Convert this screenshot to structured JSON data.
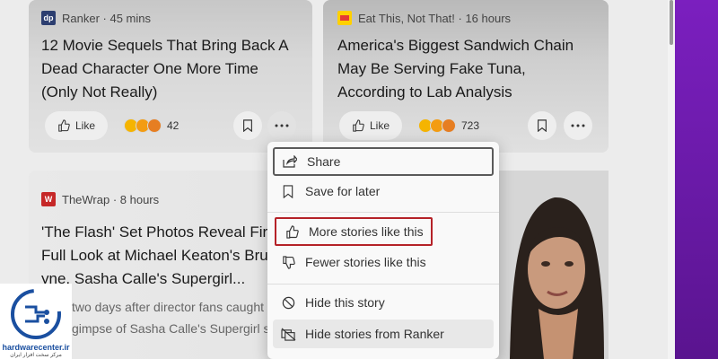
{
  "cards": {
    "card1": {
      "source": "Ranker",
      "time": "45 mins",
      "source_line": "Ranker · 45 mins",
      "logo_text": "dp",
      "headline_lines": [
        "12 Movie Sequels That Bring Back A",
        "Dead Character One More Time",
        "(Only Not Really)"
      ],
      "like_label": "Like",
      "reaction_count": "42"
    },
    "card2": {
      "source_line": "Eat This, Not That! · 16 hours",
      "headline_lines": [
        "America's Biggest Sandwich Chain",
        "May Be Serving Fake Tuna,",
        "According to Lab Analysis"
      ],
      "like_label": "Like",
      "reaction_count": "723"
    },
    "card3": {
      "source_line": "TheWrap · 8 hours",
      "logo_text": "W",
      "headline_lines": [
        "'The Flash' Set Photos Reveal Firs",
        "Full Look at Michael Keaton's Bru",
        "yne, Sasha Calle's Supergirl..."
      ],
      "snippet_lines": [
        "two days after director fans caught",
        "gimpse of Sasha Calle's Supergirl suit"
      ]
    }
  },
  "menu": {
    "items": [
      {
        "label": "Share",
        "icon": "share-icon"
      },
      {
        "label": "Save for later",
        "icon": "bookmark-icon"
      },
      {
        "label": "More stories like this",
        "icon": "thumbs-up-icon"
      },
      {
        "label": "Fewer stories like this",
        "icon": "thumbs-down-icon"
      },
      {
        "label": "Hide this story",
        "icon": "block-icon"
      },
      {
        "label": "Hide stories from Ranker",
        "icon": "hide-source-icon"
      }
    ]
  },
  "watermark": {
    "line1": "hardwarecenter.ir",
    "line2": "مرکز سخت افزار ایران"
  },
  "colors": {
    "highlight_border": "#b52228",
    "purple_accent": "#6a1aa8",
    "ranker_logo": "#2c3e70",
    "eatthis_logo": "#e53935",
    "thewrap_logo": "#c62828"
  }
}
